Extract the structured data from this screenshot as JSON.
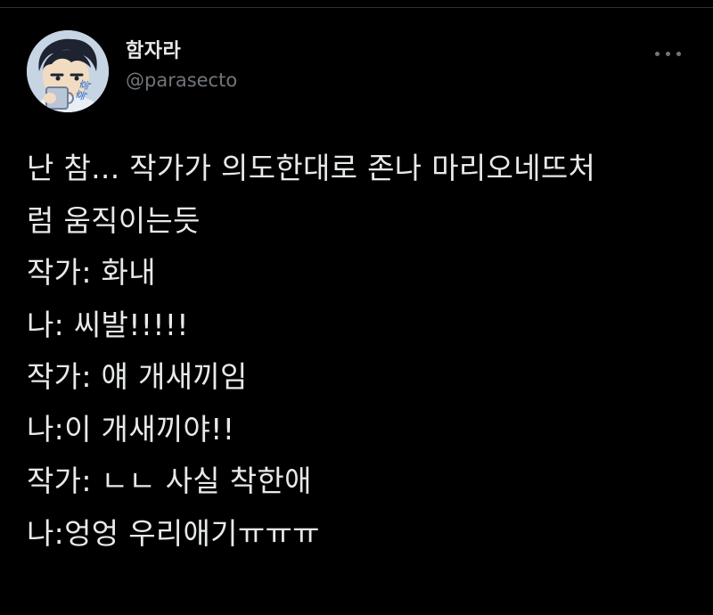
{
  "author": {
    "display_name": "함자라",
    "handle": "@parasecto"
  },
  "tweet": {
    "lines": [
      "난 참... 작가가 의도한대로 존나 마리오네뜨처",
      "럼 움직이는듯",
      "작가: 화내",
      "나: 씨발!!!!!",
      "작가: 얘 개새끼임",
      "나:이 개새끼야!!",
      "작가: ㄴㄴ 사실 착한애",
      "나:엉엉 우리애기ㅠㅠㅠ"
    ]
  },
  "avatar_text": "흑흑",
  "colors": {
    "background": "#000000",
    "text": "#e7e9ea",
    "secondary_text": "#71767b",
    "divider": "#2f3336"
  },
  "icons": {
    "more": "more-horizontal-icon"
  }
}
